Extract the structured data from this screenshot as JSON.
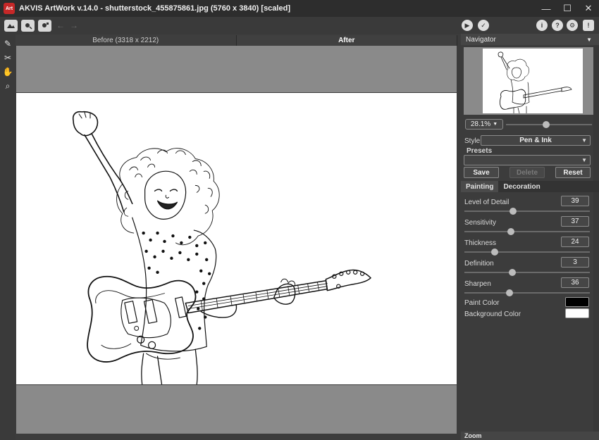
{
  "window": {
    "logo_text": "Art",
    "title": "AKVIS ArtWork v.14.0 - shutterstock_455875861.jpg (5760 x 3840) [scaled]",
    "controls": [
      "—",
      "☐",
      "✕"
    ]
  },
  "toolbar": {
    "left_buttons": [
      {
        "icon": "open-image-icon"
      },
      {
        "icon": "save-image-icon"
      },
      {
        "icon": "print-image-icon"
      }
    ],
    "undo_label": "←",
    "redo_label": "→",
    "run_label": "▶",
    "apply_label": "✓",
    "info_label": "i",
    "help_label": "?",
    "settings_label": "⚙",
    "notify_label": "!"
  },
  "tools": [
    {
      "icon": "brush-icon",
      "glyph": "✎"
    },
    {
      "icon": "eraser-icon",
      "glyph": "✂"
    },
    {
      "icon": "hand-icon",
      "glyph": "✋"
    },
    {
      "icon": "zoom-icon",
      "glyph": "⌕"
    }
  ],
  "canvas": {
    "tabs": [
      {
        "label": "Before (3318 x 2212)",
        "active": false
      },
      {
        "label": "After",
        "active": true
      }
    ]
  },
  "navigator": {
    "title": "Navigator",
    "menu_arrow": "▼",
    "zoom_value": "28.1%",
    "zoom_arrow": "▼",
    "zoom_slider_level": 0.47
  },
  "settings": {
    "style_label": "Style:",
    "style_value": "Pen & Ink",
    "style_arrow": "▼",
    "presets_label": "Presets",
    "presets_value": "",
    "presets_arrow": "▼",
    "save_label": "Save",
    "delete_label": "Delete",
    "reset_label": "Reset",
    "tabs": [
      {
        "label": "Painting",
        "active": true
      },
      {
        "label": "Decoration",
        "active": false
      }
    ],
    "params": [
      {
        "name": "Level of Detail",
        "value": "39",
        "level": 0.39
      },
      {
        "name": "Sensitivity",
        "value": "37",
        "level": 0.37
      },
      {
        "name": "Thickness",
        "value": "24",
        "level": 0.24
      },
      {
        "name": "Definition",
        "value": "3",
        "level": 0.38
      },
      {
        "name": "Sharpen",
        "value": "36",
        "level": 0.36
      }
    ],
    "paint_color_label": "Paint Color",
    "paint_color": "#000000",
    "background_color_label": "Background Color",
    "background_color": "#ffffff"
  },
  "footer": {
    "zoom_title": "Zoom"
  }
}
